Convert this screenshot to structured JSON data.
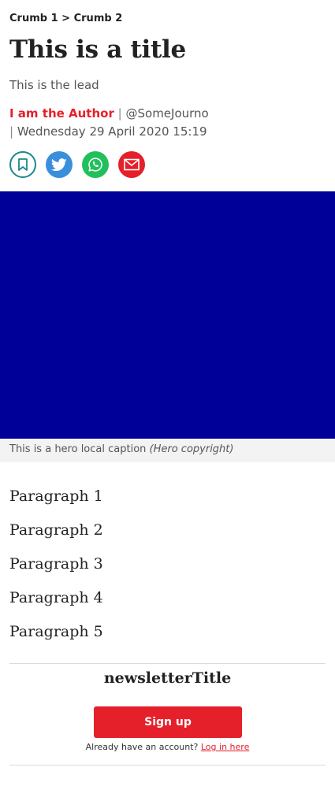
{
  "breadcrumb": {
    "items": [
      "Crumb 1",
      "Crumb 2"
    ],
    "separator": ">"
  },
  "article": {
    "title": "This is a title",
    "lead": "This is the lead",
    "author": "I am the Author",
    "author_handle": "@SomeJourno",
    "pipe": "|",
    "date": "Wednesday 29 April 2020 15:19"
  },
  "share": {
    "icons": [
      "bookmark-icon",
      "twitter-icon",
      "whatsapp-icon",
      "email-icon"
    ],
    "colors": {
      "bookmark_border": "#1a8a8a",
      "twitter": "#3a8fdd",
      "whatsapp": "#22c05c",
      "email": "#e5202b"
    }
  },
  "hero": {
    "color": "#000099",
    "caption": "This is a hero local caption",
    "copyright": "(Hero copyright)"
  },
  "paragraphs": [
    "Paragraph 1",
    "Paragraph 2",
    "Paragraph 3",
    "Paragraph 4",
    "Paragraph 5"
  ],
  "newsletter": {
    "title": "newsletterTitle",
    "signup_label": "Sign up",
    "account_prompt": "Already have an account?",
    "login_label": "Log in here"
  },
  "colors": {
    "accent": "#e5202b"
  }
}
